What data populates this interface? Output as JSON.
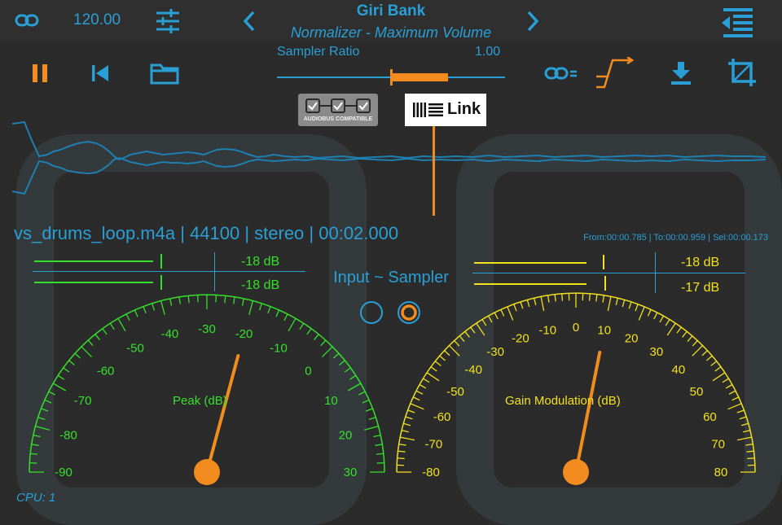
{
  "header": {
    "link_value": "120.00",
    "bank_title": "Giri Bank",
    "preset_name": "Normalizer - Maximum Volume",
    "sampler_ratio_label": "Sampler Ratio",
    "sampler_ratio_value": "1.00",
    "sampler_ratio_level": 0.5
  },
  "badges": {
    "audiobus_text": "AUDIOBUS COMPATIBLE",
    "link_text": "Link"
  },
  "file": {
    "info": "vs_drums_loop.m4a | 44100 | stereo  | 00:02.000",
    "selection": "From:00:00.785 | To:00:00.959 | Sel:00:00.173"
  },
  "meters": {
    "left": {
      "top_db": "-18 dB",
      "bottom_db": "-18 dB"
    },
    "right": {
      "top_db": "-18 dB",
      "bottom_db": "-17 dB"
    }
  },
  "input_label": "Input ~ Sampler",
  "gauges": {
    "peak": {
      "title": "Peak (dB)",
      "ticks": [
        "-90",
        "-80",
        "-70",
        "-60",
        "-50",
        "-40",
        "-30",
        "-20",
        "-10",
        "0",
        "10",
        "20",
        "30"
      ],
      "needle_value": -20
    },
    "gain": {
      "title": "Gain Modulation (dB)",
      "ticks": [
        "-80",
        "-70",
        "-60",
        "-50",
        "-40",
        "-30",
        "-20",
        "-10",
        "0",
        "10",
        "20",
        "30",
        "40",
        "50",
        "60",
        "70",
        "80"
      ],
      "needle_value": 10
    }
  },
  "cpu": "CPU: 1",
  "colors": {
    "accent_blue": "#2a9fd6",
    "accent_orange": "#f28c1e",
    "gauge_green": "#35e02b",
    "gauge_yellow": "#f2e01c"
  }
}
